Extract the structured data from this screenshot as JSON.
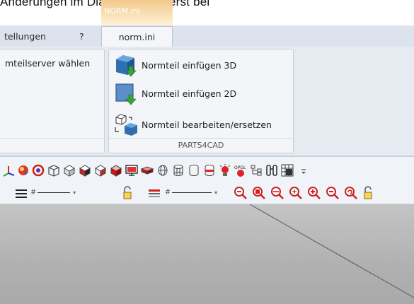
{
  "doc": {
    "top_text": "Änderungen im Dialog werden erst bei"
  },
  "context_tab": {
    "label": "NORM.ini"
  },
  "tabs": [
    {
      "label": "tellungen"
    },
    {
      "label": "?"
    },
    {
      "label": "norm.ini"
    }
  ],
  "ribbon": {
    "left_group": {
      "item_label": "mteilserver wählen"
    },
    "parts_group": {
      "label": "PARTS4CAD",
      "items": [
        {
          "label": "Normteil einfügen 3D",
          "icon": "cube-3d-insert-icon"
        },
        {
          "label": "Normteil einfügen 2D",
          "icon": "square-2d-insert-icon"
        },
        {
          "label": "Normteil bearbeiten/ersetzen",
          "icon": "cube-replace-icon"
        }
      ]
    }
  },
  "toolbar2": {
    "dash_symbol_1": "#",
    "dash_symbol_2": "#"
  },
  "colors": {
    "accent_blue": "#3b7fc4",
    "arrow_green": "#3aa23a",
    "zoom_red": "#d22b2b"
  }
}
